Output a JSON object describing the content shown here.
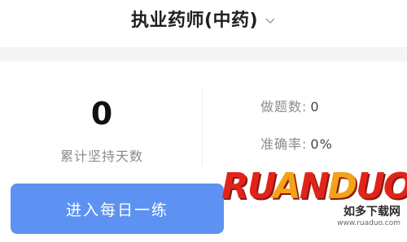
{
  "header": {
    "title": "执业药师(中药)"
  },
  "stats": {
    "days_value": "0",
    "days_label": "累计坚持天数",
    "questions_label": "做题数:",
    "questions_value": "0",
    "accuracy_label": "准确率:",
    "accuracy_value": "0%"
  },
  "action": {
    "daily_practice_label": "进入每日一练"
  },
  "watermark": {
    "logo_text": "RUANDUO",
    "site_name": "如多下载网",
    "url": "www.ruaduo.com"
  },
  "colors": {
    "button": "#5d92f2",
    "logo_red": "#e2231a",
    "logo_orange": "#f4a218"
  }
}
